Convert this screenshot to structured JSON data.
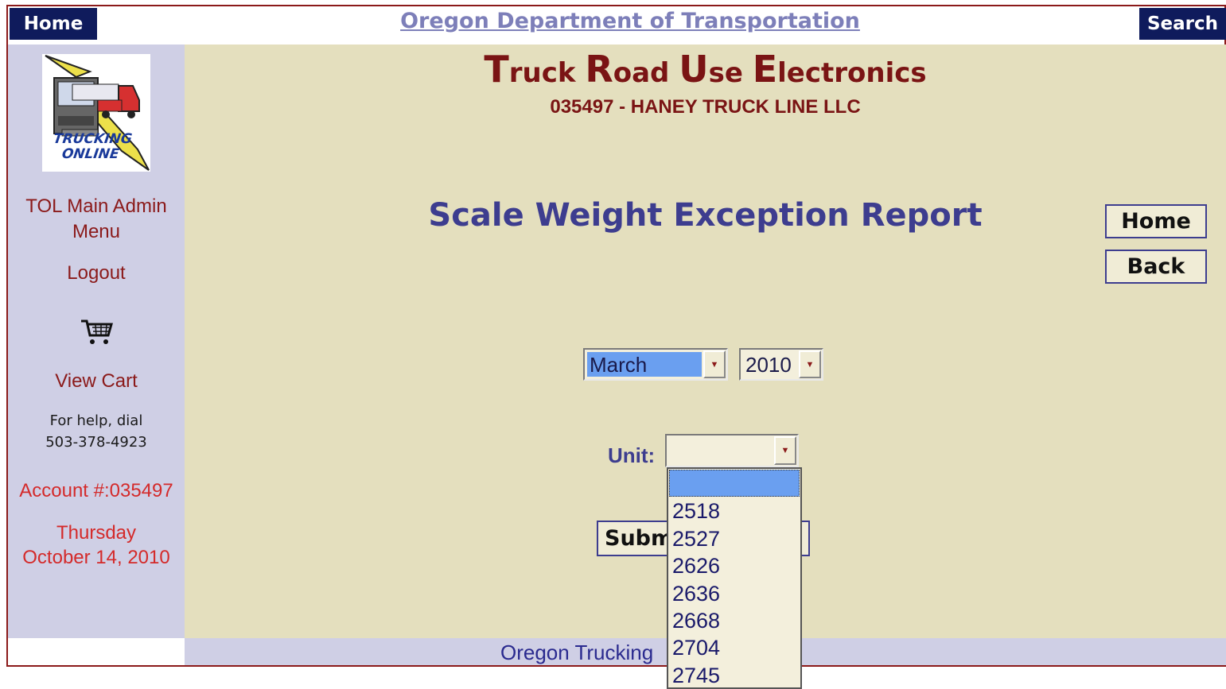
{
  "topbar": {
    "home_label": "Home",
    "title": "Oregon Department of Transportation",
    "search_label": "Search"
  },
  "sidebar": {
    "logo_text": "TRUCKING ONLINE",
    "main_menu": "TOL Main Admin Menu",
    "logout": "Logout",
    "cart_icon": "shopping-cart-icon",
    "view_cart": "View Cart",
    "help_line1": "For help, dial",
    "help_line2": "503-378-4923",
    "account": "Account #:035497",
    "date_day": "Thursday",
    "date_full": "October 14, 2010"
  },
  "header": {
    "app_title_parts": [
      "T",
      "ruck ",
      "R",
      "oad ",
      "U",
      "se ",
      "E",
      "lectronics"
    ],
    "company": "035497 - HANEY TRUCK LINE LLC",
    "report_title": "Scale Weight Exception Report"
  },
  "nav": {
    "home_label": "Home",
    "back_label": "Back"
  },
  "form": {
    "month_value": "March",
    "year_value": "2010",
    "unit_label": "Unit:",
    "unit_value": "",
    "submit_label": "Submit",
    "unit_options": [
      "",
      "2518",
      "2527",
      "2626",
      "2636",
      "2668",
      "2704",
      "2745"
    ]
  },
  "footer": {
    "text": "Oregon Trucking"
  },
  "colors": {
    "nav_bar": "#0f1b5c",
    "sidebar": "#cfcfe5",
    "main_bg": "#e4dfbe",
    "title_red": "#7a1414",
    "report_blue": "#3d3d8f",
    "selected_option": "#6a9ff0"
  }
}
